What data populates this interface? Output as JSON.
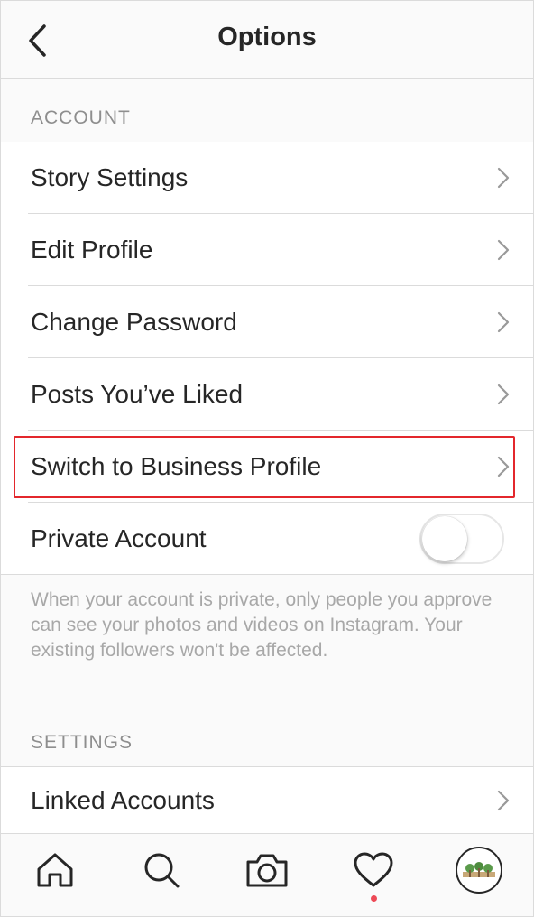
{
  "header": {
    "title": "Options",
    "back_icon": "chevron-left-icon"
  },
  "account_section": {
    "label": "ACCOUNT",
    "items": [
      {
        "label": "Story Settings"
      },
      {
        "label": "Edit Profile"
      },
      {
        "label": "Change Password"
      },
      {
        "label": "Posts You’ve Liked"
      },
      {
        "label": "Switch to Business Profile",
        "highlighted": true
      }
    ],
    "private_account": {
      "label": "Private Account",
      "toggle_on": false
    },
    "private_note": "When your account is private, only people you approve can see your photos and videos on Instagram. Your existing followers won't be affected."
  },
  "settings_section": {
    "label": "SETTINGS",
    "items": [
      {
        "label": "Linked Accounts"
      }
    ]
  },
  "tabbar": {
    "tabs": [
      {
        "icon": "home-icon"
      },
      {
        "icon": "search-icon"
      },
      {
        "icon": "camera-icon"
      },
      {
        "icon": "heart-icon",
        "notification_dot": true
      },
      {
        "icon": "profile-avatar"
      }
    ]
  },
  "colors": {
    "highlight": "#e3272c",
    "notification_dot": "#ed4956",
    "divider": "#dbdbdb",
    "secondary_text": "#8e8e8e"
  }
}
